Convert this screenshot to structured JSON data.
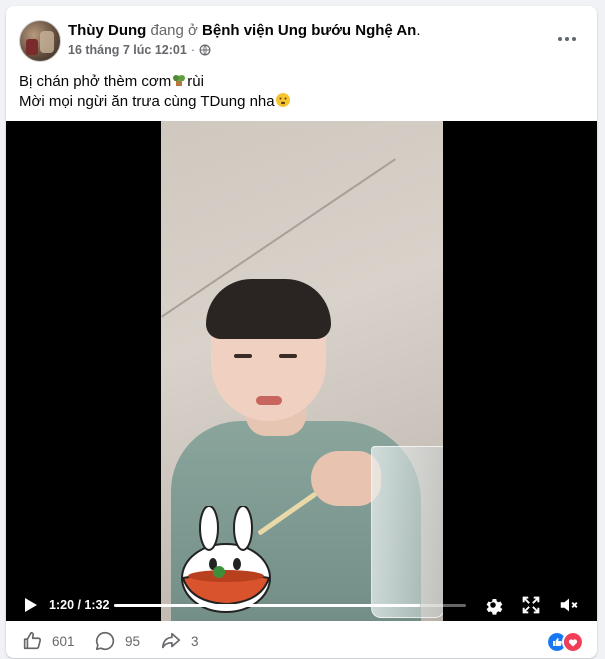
{
  "post": {
    "author": "Thùy Dung",
    "checkin_text": "đang ở",
    "location": "Bệnh viện Ung bướu Nghệ An",
    "location_suffix": ".",
    "date": "16 tháng 7 lúc 12:01",
    "separator": "·",
    "line1": "Bị chán phở thèm cơm",
    "line1_tail": "rùi",
    "line2": "Mời mọi ngừi ăn trưa cùng TDung nha"
  },
  "video": {
    "time_display": "1:20 / 1:32",
    "progress": 0.87,
    "sticker_colors": {
      "bowl": "#d9532d",
      "body": "#ffffff"
    }
  },
  "actions": {
    "likes": "601",
    "comments": "95",
    "shares": "3"
  },
  "colors": {
    "like_blue": "#1877f2",
    "love_red": "#f33e58",
    "muted": "#65676b"
  },
  "icons": [
    "globe-icon",
    "more-icon",
    "plant-emoji",
    "smile-emoji",
    "play-icon",
    "settings-icon",
    "fullscreen-icon",
    "mute-icon",
    "like-icon",
    "comment-icon",
    "share-icon"
  ]
}
